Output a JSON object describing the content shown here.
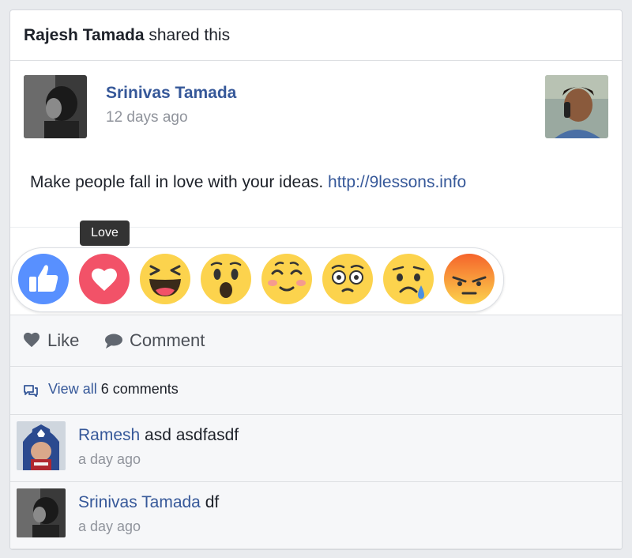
{
  "share": {
    "sharer": "Rajesh Tamada",
    "text": "shared this"
  },
  "post": {
    "author": "Srinivas Tamada",
    "time": "12 days ago",
    "text": "Make people fall in love with your ideas.",
    "link": "http://9lessons.info"
  },
  "tooltip": "Love",
  "reactions": [
    "like",
    "love",
    "haha",
    "wow",
    "cool",
    "confused",
    "sad",
    "angry"
  ],
  "actions": {
    "like": "Like",
    "comment": "Comment"
  },
  "comments_bar": {
    "view_all": "View all",
    "count_text": "6 comments"
  },
  "comments": [
    {
      "author": "Ramesh",
      "text": "asd asdfasdf",
      "time": "a day ago"
    },
    {
      "author": "Srinivas Tamada",
      "text": "df",
      "time": "a day ago"
    }
  ],
  "colors": {
    "link": "#365899",
    "love": "#f25268",
    "like": "#5890ff",
    "emoji": "#fcd34d",
    "angry": "#f5642b"
  }
}
